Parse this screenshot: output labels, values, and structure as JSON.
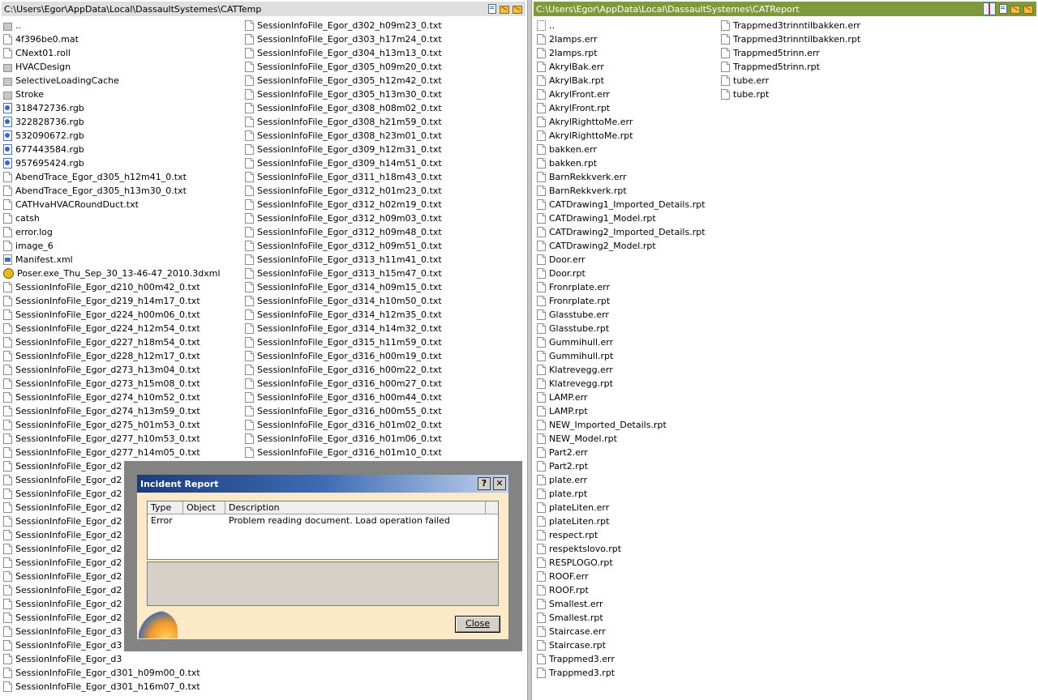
{
  "left_pane": {
    "path": "C:\\Users\\Egor\\AppData\\Local\\DassaultSystemes\\CATTemp",
    "col1": [
      {
        "name": "..",
        "icon": "folder-icon"
      },
      {
        "name": "4f396be0.mat",
        "icon": "document-icon"
      },
      {
        "name": "CNext01.roll",
        "icon": "document-icon"
      },
      {
        "name": "HVACDesign",
        "icon": "folder-icon"
      },
      {
        "name": "SelectiveLoadingCache",
        "icon": "folder-icon"
      },
      {
        "name": "Stroke",
        "icon": "folder-icon"
      },
      {
        "name": "318472736.rgb",
        "icon": "image-icon"
      },
      {
        "name": "322828736.rgb",
        "icon": "image-icon"
      },
      {
        "name": "532090672.rgb",
        "icon": "image-icon"
      },
      {
        "name": "677443584.rgb",
        "icon": "image-icon"
      },
      {
        "name": "957695424.rgb",
        "icon": "image-icon"
      },
      {
        "name": "AbendTrace_Egor_d305_h12m41_0.txt",
        "icon": "document-icon"
      },
      {
        "name": "AbendTrace_Egor_d305_h13m30_0.txt",
        "icon": "document-icon"
      },
      {
        "name": "CATHvaHVACRoundDuct.txt",
        "icon": "document-icon"
      },
      {
        "name": "catsh",
        "icon": "document-icon"
      },
      {
        "name": "error.log",
        "icon": "document-icon"
      },
      {
        "name": "image_6",
        "icon": "document-icon"
      },
      {
        "name": "Manifest.xml",
        "icon": "xml-icon"
      },
      {
        "name": "Poser.exe_Thu_Sep_30_13-46-47_2010.3dxml",
        "icon": "3dxml-icon"
      },
      {
        "name": "SessionInfoFile_Egor_d210_h00m42_0.txt",
        "icon": "document-icon"
      },
      {
        "name": "SessionInfoFile_Egor_d219_h14m17_0.txt",
        "icon": "document-icon"
      },
      {
        "name": "SessionInfoFile_Egor_d224_h00m06_0.txt",
        "icon": "document-icon"
      },
      {
        "name": "SessionInfoFile_Egor_d224_h12m54_0.txt",
        "icon": "document-icon"
      },
      {
        "name": "SessionInfoFile_Egor_d227_h18m54_0.txt",
        "icon": "document-icon"
      },
      {
        "name": "SessionInfoFile_Egor_d228_h12m17_0.txt",
        "icon": "document-icon"
      },
      {
        "name": "SessionInfoFile_Egor_d273_h13m04_0.txt",
        "icon": "document-icon"
      },
      {
        "name": "SessionInfoFile_Egor_d273_h15m08_0.txt",
        "icon": "document-icon"
      },
      {
        "name": "SessionInfoFile_Egor_d274_h10m52_0.txt",
        "icon": "document-icon"
      },
      {
        "name": "SessionInfoFile_Egor_d274_h13m59_0.txt",
        "icon": "document-icon"
      },
      {
        "name": "SessionInfoFile_Egor_d275_h01m53_0.txt",
        "icon": "document-icon"
      },
      {
        "name": "SessionInfoFile_Egor_d277_h10m53_0.txt",
        "icon": "document-icon"
      },
      {
        "name": "SessionInfoFile_Egor_d277_h14m05_0.txt",
        "icon": "document-icon"
      },
      {
        "name": "SessionInfoFile_Egor_d2",
        "icon": "document-icon"
      },
      {
        "name": "SessionInfoFile_Egor_d2",
        "icon": "document-icon"
      },
      {
        "name": "SessionInfoFile_Egor_d2",
        "icon": "document-icon"
      },
      {
        "name": "SessionInfoFile_Egor_d2",
        "icon": "document-icon"
      },
      {
        "name": "SessionInfoFile_Egor_d2",
        "icon": "document-icon"
      },
      {
        "name": "SessionInfoFile_Egor_d2",
        "icon": "document-icon"
      },
      {
        "name": "SessionInfoFile_Egor_d2",
        "icon": "document-icon"
      },
      {
        "name": "SessionInfoFile_Egor_d2",
        "icon": "document-icon"
      },
      {
        "name": "SessionInfoFile_Egor_d2",
        "icon": "document-icon"
      },
      {
        "name": "SessionInfoFile_Egor_d2",
        "icon": "document-icon"
      },
      {
        "name": "SessionInfoFile_Egor_d2",
        "icon": "document-icon"
      },
      {
        "name": "SessionInfoFile_Egor_d2",
        "icon": "document-icon"
      },
      {
        "name": "SessionInfoFile_Egor_d3",
        "icon": "document-icon"
      },
      {
        "name": "SessionInfoFile_Egor_d3",
        "icon": "document-icon"
      },
      {
        "name": "SessionInfoFile_Egor_d3",
        "icon": "document-icon"
      },
      {
        "name": "SessionInfoFile_Egor_d301_h09m00_0.txt",
        "icon": "document-icon"
      },
      {
        "name": "SessionInfoFile_Egor_d301_h16m07_0.txt",
        "icon": "document-icon"
      }
    ],
    "col2": [
      "SessionInfoFile_Egor_d302_h09m23_0.txt",
      "SessionInfoFile_Egor_d303_h17m24_0.txt",
      "SessionInfoFile_Egor_d304_h13m13_0.txt",
      "SessionInfoFile_Egor_d305_h09m20_0.txt",
      "SessionInfoFile_Egor_d305_h12m42_0.txt",
      "SessionInfoFile_Egor_d305_h13m30_0.txt",
      "SessionInfoFile_Egor_d308_h08m02_0.txt",
      "SessionInfoFile_Egor_d308_h21m59_0.txt",
      "SessionInfoFile_Egor_d308_h23m01_0.txt",
      "SessionInfoFile_Egor_d309_h12m31_0.txt",
      "SessionInfoFile_Egor_d309_h14m51_0.txt",
      "SessionInfoFile_Egor_d311_h18m43_0.txt",
      "SessionInfoFile_Egor_d312_h01m23_0.txt",
      "SessionInfoFile_Egor_d312_h02m19_0.txt",
      "SessionInfoFile_Egor_d312_h09m03_0.txt",
      "SessionInfoFile_Egor_d312_h09m48_0.txt",
      "SessionInfoFile_Egor_d312_h09m51_0.txt",
      "SessionInfoFile_Egor_d313_h11m41_0.txt",
      "SessionInfoFile_Egor_d313_h15m47_0.txt",
      "SessionInfoFile_Egor_d314_h09m15_0.txt",
      "SessionInfoFile_Egor_d314_h10m50_0.txt",
      "SessionInfoFile_Egor_d314_h12m35_0.txt",
      "SessionInfoFile_Egor_d314_h14m32_0.txt",
      "SessionInfoFile_Egor_d315_h11m59_0.txt",
      "SessionInfoFile_Egor_d316_h00m19_0.txt",
      "SessionInfoFile_Egor_d316_h00m22_0.txt",
      "SessionInfoFile_Egor_d316_h00m27_0.txt",
      "SessionInfoFile_Egor_d316_h00m44_0.txt",
      "SessionInfoFile_Egor_d316_h00m55_0.txt",
      "SessionInfoFile_Egor_d316_h01m02_0.txt",
      "SessionInfoFile_Egor_d316_h01m06_0.txt",
      "SessionInfoFile_Egor_d316_h01m10_0.txt"
    ]
  },
  "right_pane": {
    "path": "C:\\Users\\Egor\\AppData\\Local\\DassaultSystemes\\CATReport",
    "col1": [
      "..",
      "2lamps.err",
      "2lamps.rpt",
      "AkrylBak.err",
      "AkrylBak.rpt",
      "AkrylFront.err",
      "AkrylFront.rpt",
      "AkrylRighttoMe.err",
      "AkrylRighttoMe.rpt",
      "bakken.err",
      "bakken.rpt",
      "BarnRekkverk.err",
      "BarnRekkverk.rpt",
      "CATDrawing1_Imported_Details.rpt",
      "CATDrawing1_Model.rpt",
      "CATDrawing2_Imported_Details.rpt",
      "CATDrawing2_Model.rpt",
      "Door.err",
      "Door.rpt",
      "Fronrplate.err",
      "Fronrplate.rpt",
      "Glasstube.err",
      "Glasstube.rpt",
      "Gummihull.err",
      "Gummihull.rpt",
      "Klatrevegg.err",
      "Klatrevegg.rpt",
      "LAMP.err",
      "LAMP.rpt",
      "NEW_Imported_Details.rpt",
      "NEW_Model.rpt",
      "Part2.err",
      "Part2.rpt",
      "plate.err",
      "plate.rpt",
      "plateLiten.err",
      "plateLiten.rpt",
      "respect.rpt",
      "respektslovo.rpt",
      "RESPLOGO.rpt",
      "ROOF.err",
      "ROOF.rpt",
      "Smallest.err",
      "Smallest.rpt",
      "Staircase.err",
      "Staircase.rpt",
      "Trappmed3.err",
      "Trappmed3.rpt"
    ],
    "col2": [
      "Trappmed3trinntilbakken.err",
      "Trappmed3trinntilbakken.rpt",
      "Trappmed5trinn.err",
      "Trappmed5trinn.rpt",
      "tube.err",
      "tube.rpt"
    ]
  },
  "dialog": {
    "title": "Incident Report",
    "help_label": "?",
    "close_x_label": "✕",
    "columns": [
      "Type",
      "Object",
      "Description"
    ],
    "rows": [
      {
        "type": "Error",
        "object": "",
        "description": "Problem reading document. Load operation failed"
      }
    ],
    "close_label": "Close"
  },
  "colors": {
    "right_title_bg": "#7f9a3d",
    "dialog_bg": "#fbe9c8",
    "dialog_title": "#1b3c7a"
  }
}
